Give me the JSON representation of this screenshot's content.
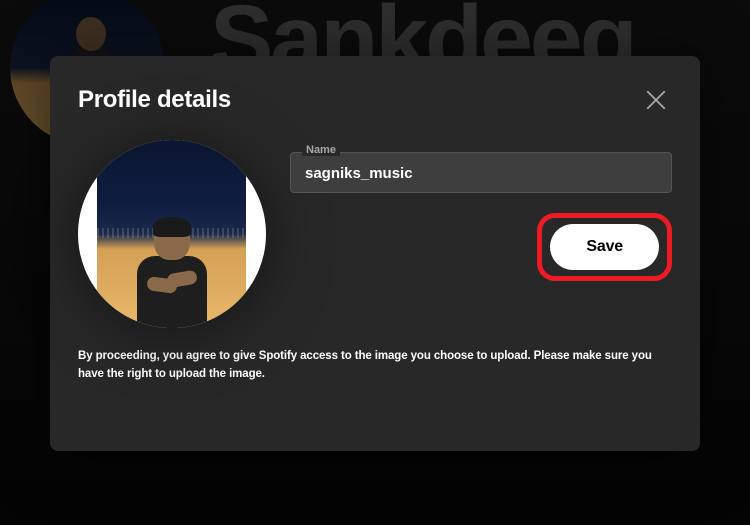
{
  "backdrop": {
    "title_partial": "Sankdeeg"
  },
  "modal": {
    "title": "Profile details",
    "name_field": {
      "label": "Name",
      "value": "sagniks_music"
    },
    "save_label": "Save",
    "disclaimer": "By proceeding, you agree to give Spotify access to the image you choose to upload. Please make sure you have the right to upload the image."
  }
}
